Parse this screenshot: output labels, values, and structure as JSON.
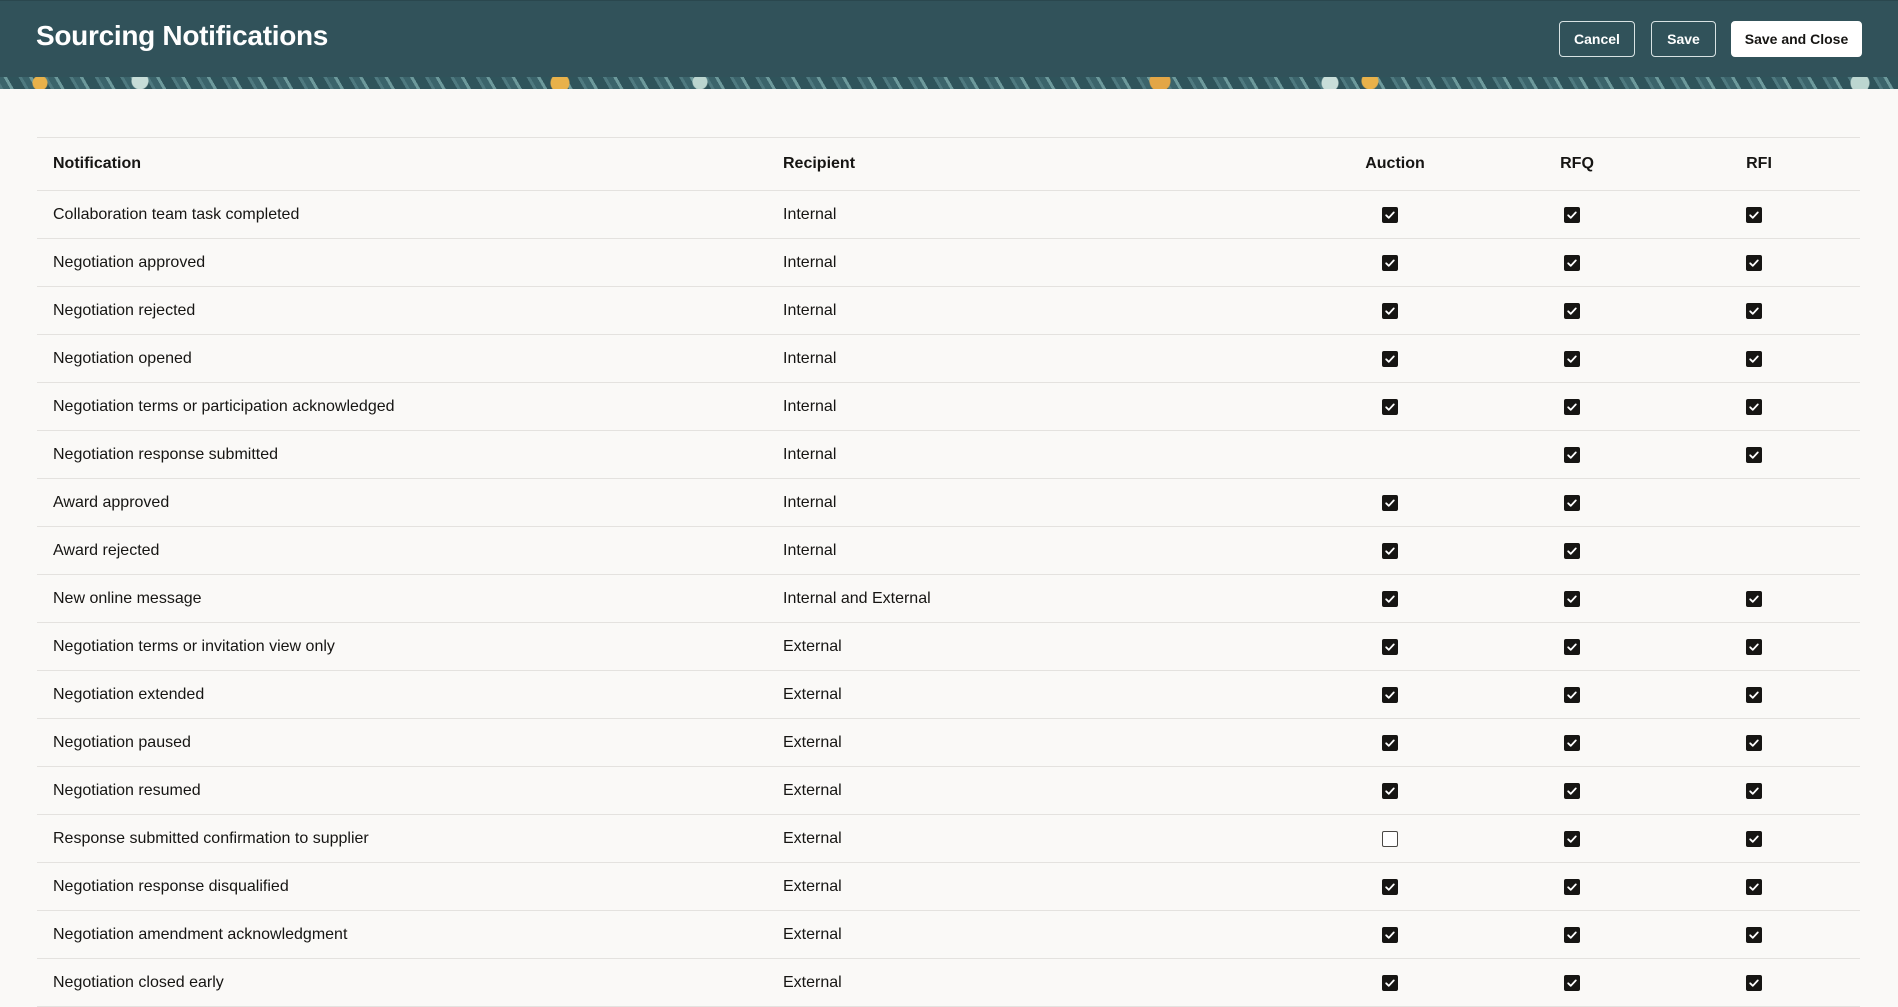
{
  "header": {
    "title": "Sourcing Notifications",
    "buttons": {
      "cancel": "Cancel",
      "save": "Save",
      "save_close": "Save and Close"
    }
  },
  "table": {
    "columns": {
      "notification": "Notification",
      "recipient": "Recipient",
      "auction": "Auction",
      "rfq": "RFQ",
      "rfi": "RFI"
    },
    "rows": [
      {
        "notification": "Collaboration team task completed",
        "recipient": "Internal",
        "auction": "checked",
        "rfq": "checked",
        "rfi": "checked"
      },
      {
        "notification": "Negotiation approved",
        "recipient": "Internal",
        "auction": "checked",
        "rfq": "checked",
        "rfi": "checked"
      },
      {
        "notification": "Negotiation rejected",
        "recipient": "Internal",
        "auction": "checked",
        "rfq": "checked",
        "rfi": "checked"
      },
      {
        "notification": "Negotiation opened",
        "recipient": "Internal",
        "auction": "checked",
        "rfq": "checked",
        "rfi": "checked"
      },
      {
        "notification": "Negotiation terms or participation acknowledged",
        "recipient": "Internal",
        "auction": "checked",
        "rfq": "checked",
        "rfi": "checked"
      },
      {
        "notification": "Negotiation response submitted",
        "recipient": "Internal",
        "auction": "none",
        "rfq": "checked",
        "rfi": "checked"
      },
      {
        "notification": "Award approved",
        "recipient": "Internal",
        "auction": "checked",
        "rfq": "checked",
        "rfi": "none"
      },
      {
        "notification": "Award rejected",
        "recipient": "Internal",
        "auction": "checked",
        "rfq": "checked",
        "rfi": "none"
      },
      {
        "notification": "New online message",
        "recipient": "Internal and External",
        "auction": "checked",
        "rfq": "checked",
        "rfi": "checked"
      },
      {
        "notification": "Negotiation terms or invitation view only",
        "recipient": "External",
        "auction": "checked",
        "rfq": "checked",
        "rfi": "checked"
      },
      {
        "notification": "Negotiation extended",
        "recipient": "External",
        "auction": "checked",
        "rfq": "checked",
        "rfi": "checked"
      },
      {
        "notification": "Negotiation paused",
        "recipient": "External",
        "auction": "checked",
        "rfq": "checked",
        "rfi": "checked"
      },
      {
        "notification": "Negotiation resumed",
        "recipient": "External",
        "auction": "checked",
        "rfq": "checked",
        "rfi": "checked"
      },
      {
        "notification": "Response submitted confirmation to supplier",
        "recipient": "External",
        "auction": "unchecked",
        "rfq": "checked",
        "rfi": "checked"
      },
      {
        "notification": "Negotiation response disqualified",
        "recipient": "External",
        "auction": "checked",
        "rfq": "checked",
        "rfi": "checked"
      },
      {
        "notification": "Negotiation amendment acknowledgment",
        "recipient": "External",
        "auction": "checked",
        "rfq": "checked",
        "rfi": "checked"
      },
      {
        "notification": "Negotiation closed early",
        "recipient": "External",
        "auction": "checked",
        "rfq": "checked",
        "rfi": "checked"
      }
    ]
  },
  "colors": {
    "header_bg": "#31525a",
    "page_bg": "#faf9f7",
    "checkbox_on": "#161513"
  },
  "icons": {
    "checkbox_checked": "check-icon"
  }
}
